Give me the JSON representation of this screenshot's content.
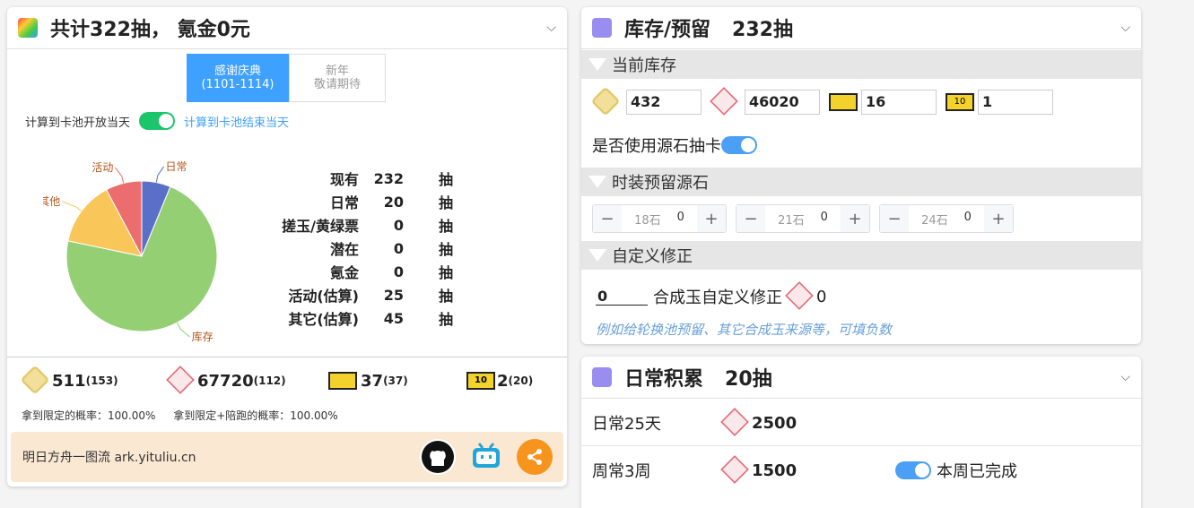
{
  "left": {
    "title": "共计322抽， 氪金0元",
    "tabs": [
      {
        "line1": "感谢庆典",
        "line2": "(1101-1114)",
        "active": true
      },
      {
        "line1": "新年",
        "line2": "敬请期待",
        "active": false
      }
    ],
    "toggle_left_label": "计算到卡池开放当天",
    "toggle_right_label": "计算到卡池结束当天",
    "chart_data": {
      "type": "pie",
      "labels": [
        "日常",
        "库存",
        "其他",
        "活动"
      ],
      "values": [
        20,
        232,
        45,
        25
      ],
      "colors": [
        "#5a70c8",
        "#94cf74",
        "#f9c65a",
        "#ec6d6d"
      ]
    },
    "stats": [
      {
        "label": "现有",
        "value": "232",
        "unit": "抽"
      },
      {
        "label": "日常",
        "value": "20",
        "unit": "抽"
      },
      {
        "label": "搓玉/黄绿票",
        "value": "0",
        "unit": "抽"
      },
      {
        "label": "潜在",
        "value": "0",
        "unit": "抽"
      },
      {
        "label": "氪金",
        "value": "0",
        "unit": "抽"
      },
      {
        "label": "活动(估算)",
        "value": "25",
        "unit": "抽"
      },
      {
        "label": "其它(估算)",
        "value": "45",
        "unit": "抽"
      }
    ],
    "resources": [
      {
        "icon": "originite-icon",
        "value": "511",
        "sub": "(153)"
      },
      {
        "icon": "orundum-icon",
        "value": "67720",
        "sub": "(112)"
      },
      {
        "icon": "headhunt-ticket-icon",
        "value": "37",
        "sub": "(37)"
      },
      {
        "icon": "headhunt-ticket-10-icon",
        "value": "2",
        "sub": "(20)"
      }
    ],
    "prob1": "拿到限定的概率：100.00%",
    "prob2": "拿到限定+陪跑的概率：100.00%",
    "footer_text": "明日方舟一图流 ark.yituliu.cn"
  },
  "right_top": {
    "title": "库存/预留",
    "count": "232抽",
    "section1": "当前库存",
    "inventory": [
      "432",
      "46020",
      "16",
      "1"
    ],
    "use_label": "是否使用源石抽卡",
    "section2": "时装预留源石",
    "steppers": [
      {
        "label": "18石",
        "value": "0"
      },
      {
        "label": "21石",
        "value": "0"
      },
      {
        "label": "24石",
        "value": "0"
      }
    ],
    "section3": "自定义修正",
    "custom_value": "0",
    "custom_label": "合成玉自定义修正",
    "custom_total": "0",
    "hint": "例如给轮换池预留、其它合成玉来源等，可填负数"
  },
  "right_bottom": {
    "title": "日常积累",
    "count": "20抽",
    "rows": [
      {
        "label": "日常25天",
        "amount": "2500",
        "toggle": ""
      },
      {
        "label": "周常3周",
        "amount": "1500",
        "toggle": "本周已完成"
      }
    ]
  }
}
